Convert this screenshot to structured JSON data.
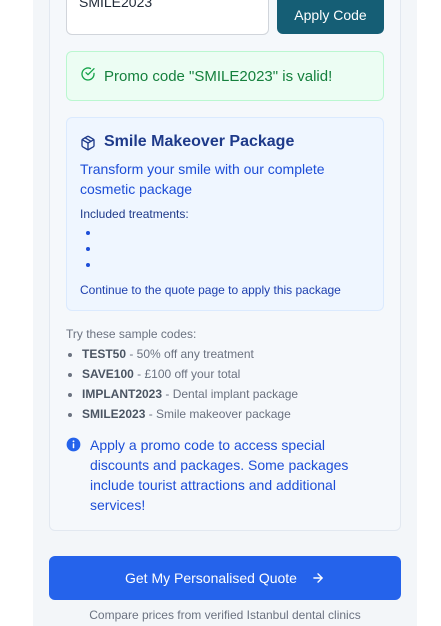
{
  "promo": {
    "input_value": "SMILE2023",
    "apply_label": "Apply Code",
    "valid_message": "Promo code \"SMILE2023\" is valid!"
  },
  "package": {
    "title": "Smile Makeover Package",
    "description": "Transform your smile with our complete cosmetic package",
    "included_label": "Included treatments:",
    "treatments": [
      "",
      "",
      ""
    ],
    "continue_note": "Continue to the quote page to apply this package"
  },
  "samples": {
    "heading": "Try these sample codes:",
    "codes": [
      {
        "code": "TEST50",
        "desc": " - 50% off any treatment"
      },
      {
        "code": "SAVE100",
        "desc": " - £100 off your total"
      },
      {
        "code": "IMPLANT2023",
        "desc": " - Dental implant package"
      },
      {
        "code": "SMILE2023",
        "desc": " - Smile makeover package"
      }
    ]
  },
  "info": {
    "text": "Apply a promo code to access special discounts and packages. Some packages include tourist attractions and additional services!"
  },
  "footer": {
    "quote_button": "Get My Personalised Quote",
    "compare_note": "Compare prices from verified Istanbul dental clinics"
  },
  "colors": {
    "apply_bg": "#155e75",
    "valid_green": "#15803d",
    "package_blue": "#1e3a8a",
    "quote_bg": "#2563eb"
  },
  "icons": {
    "valid": "check-circle-icon",
    "package": "package-box-icon",
    "info": "info-circle-icon",
    "arrow": "arrow-right-icon"
  }
}
